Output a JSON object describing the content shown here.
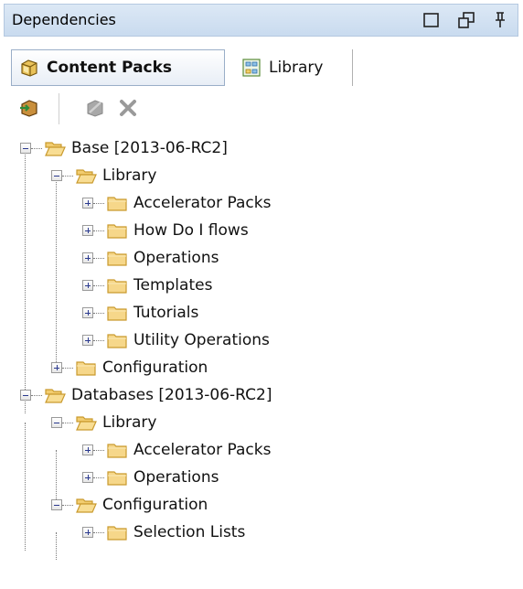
{
  "panel": {
    "title": "Dependencies"
  },
  "tabs": [
    {
      "label": "Content Packs",
      "active": true,
      "icon": "content-pack-icon"
    },
    {
      "label": "Library",
      "active": false,
      "icon": "library-icon"
    }
  ],
  "toolbar": [
    {
      "name": "import-content-pack",
      "icon": "import-icon"
    },
    {
      "name": "remove-all",
      "icon": "remove-all-icon"
    },
    {
      "name": "remove",
      "icon": "close-icon"
    }
  ],
  "tree": [
    {
      "label": "Base [2013-06-RC2]",
      "depth": 0,
      "state": "expanded"
    },
    {
      "label": "Library",
      "depth": 1,
      "state": "expanded"
    },
    {
      "label": "Accelerator Packs",
      "depth": 2,
      "state": "collapsed"
    },
    {
      "label": "How Do I flows",
      "depth": 2,
      "state": "collapsed"
    },
    {
      "label": "Operations",
      "depth": 2,
      "state": "collapsed"
    },
    {
      "label": "Templates",
      "depth": 2,
      "state": "collapsed"
    },
    {
      "label": "Tutorials",
      "depth": 2,
      "state": "collapsed"
    },
    {
      "label": "Utility Operations",
      "depth": 2,
      "state": "collapsed"
    },
    {
      "label": "Configuration",
      "depth": 1,
      "state": "collapsed"
    },
    {
      "label": "Databases [2013-06-RC2]",
      "depth": 0,
      "state": "expanded"
    },
    {
      "label": "Library",
      "depth": 1,
      "state": "expanded"
    },
    {
      "label": "Accelerator Packs",
      "depth": 2,
      "state": "collapsed"
    },
    {
      "label": "Operations",
      "depth": 2,
      "state": "collapsed"
    },
    {
      "label": "Configuration",
      "depth": 1,
      "state": "expanded"
    },
    {
      "label": "Selection Lists",
      "depth": 2,
      "state": "collapsed"
    }
  ],
  "colors": {
    "titlebar": "#c9dbef",
    "folder": "#f6d78a",
    "folder_border": "#c99a2e",
    "expander_sign": "#2b3a8f"
  }
}
